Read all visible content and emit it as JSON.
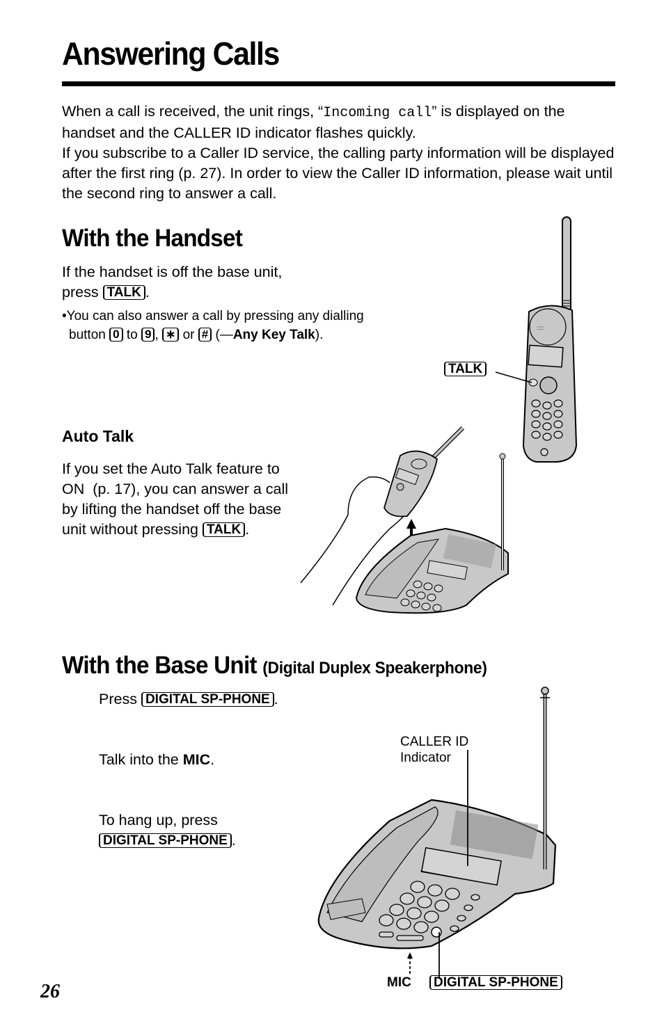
{
  "page": {
    "title": "Answering Calls",
    "page_number": "26"
  },
  "intro": {
    "p1_before": "When a call is received, the unit rings, “",
    "p1_display": "Incoming call",
    "p1_after": "” is displayed on the handset and the CALLER ID indicator flashes quickly.",
    "p2": "If you subscribe to a Caller ID service, the calling party information will be displayed after the first ring (p. 27). In order to view the Caller ID information, please wait until the second ring to answer a call."
  },
  "handset_section": {
    "heading": "With the Handset",
    "line1": "If the handset is off the base unit,",
    "line2_before": "press",
    "talk_key": "TALK",
    "line2_after": ".",
    "note_bullet": "•",
    "note_line1": "You can also answer a call by pressing any dialling",
    "note_button": "button",
    "key_0": "0",
    "note_to": "to",
    "key_9": "9",
    "comma": ",",
    "key_star": "∗",
    "note_or": "or",
    "key_hash": "#",
    "note_open": "(—",
    "any_key_talk": "Any Key Talk",
    "note_close": ").",
    "figure_label_talk": "TALK"
  },
  "auto_talk": {
    "heading": "Auto Talk",
    "text_line1": "If you set the Auto Talk feature to",
    "text_line2": "ON  (p. 17), you can answer a call",
    "text_line3": "by lifting the handset off the base",
    "text_line4_before": "unit without pressing",
    "talk_key": "TALK",
    "text_line4_after": "."
  },
  "base_section": {
    "heading": "With the Base Unit",
    "heading_sub": "(Digital Duplex Speakerphone)",
    "step1_before": "Press",
    "step1_key": "DIGITAL SP-PHONE",
    "step1_after": ".",
    "step2_before": "Talk into the",
    "step2_bold": "MIC",
    "step2_after": ".",
    "step3_line1": "To hang up, press",
    "step3_key": "DIGITAL SP-PHONE",
    "step3_after": ".",
    "figure_caller_id_line1": "CALLER ID",
    "figure_caller_id_line2": "Indicator",
    "figure_mic": "MIC",
    "figure_sp_phone": "DIGITAL SP-PHONE"
  },
  "colors": {
    "ink": "#000000",
    "device_gray": "#c8c8c8",
    "paper": "#ffffff"
  }
}
